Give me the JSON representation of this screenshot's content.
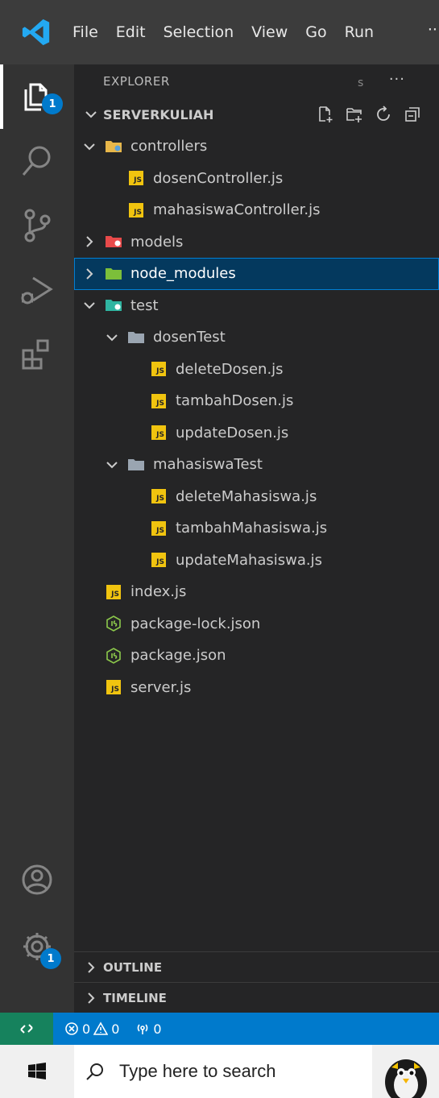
{
  "menubar": {
    "items": [
      "File",
      "Edit",
      "Selection",
      "View",
      "Go",
      "Run"
    ],
    "more": "···"
  },
  "activity": {
    "explorer_badge": "1",
    "settings_badge": "1"
  },
  "sidebar": {
    "title": "EXPLORER",
    "more": "···",
    "editor_peek": "s",
    "root_folder": "SERVERKULIAH",
    "tree": [
      {
        "label": "controllers",
        "icon": "folder-controllers-icon",
        "depth": 1,
        "kind": "folder-open"
      },
      {
        "label": "dosenController.js",
        "icon": "js-file-icon",
        "depth": 2,
        "kind": "js"
      },
      {
        "label": "mahasiswaController.js",
        "icon": "js-file-icon",
        "depth": 2,
        "kind": "js"
      },
      {
        "label": "models",
        "icon": "folder-models-icon",
        "depth": 1,
        "kind": "folder-closed"
      },
      {
        "label": "node_modules",
        "icon": "folder-node-icon",
        "depth": 1,
        "kind": "folder-closed",
        "selected": true
      },
      {
        "label": "test",
        "icon": "folder-test-icon",
        "depth": 1,
        "kind": "folder-open"
      },
      {
        "label": "dosenTest",
        "icon": "folder-icon",
        "depth": 2,
        "kind": "folder-open"
      },
      {
        "label": "deleteDosen.js",
        "icon": "js-file-icon",
        "depth": 3,
        "kind": "js"
      },
      {
        "label": "tambahDosen.js",
        "icon": "js-file-icon",
        "depth": 3,
        "kind": "js"
      },
      {
        "label": "updateDosen.js",
        "icon": "js-file-icon",
        "depth": 3,
        "kind": "js"
      },
      {
        "label": "mahasiswaTest",
        "icon": "folder-icon",
        "depth": 2,
        "kind": "folder-open"
      },
      {
        "label": "deleteMahasiswa.js",
        "icon": "js-file-icon",
        "depth": 3,
        "kind": "js"
      },
      {
        "label": "tambahMahasiswa.js",
        "icon": "js-file-icon",
        "depth": 3,
        "kind": "js"
      },
      {
        "label": "updateMahasiswa.js",
        "icon": "js-file-icon",
        "depth": 3,
        "kind": "js"
      },
      {
        "label": "index.js",
        "icon": "js-file-icon",
        "depth": 1,
        "kind": "js"
      },
      {
        "label": "package-lock.json",
        "icon": "node-json-icon",
        "depth": 1,
        "kind": "json"
      },
      {
        "label": "package.json",
        "icon": "node-json-icon",
        "depth": 1,
        "kind": "json"
      },
      {
        "label": "server.js",
        "icon": "js-file-icon",
        "depth": 1,
        "kind": "js"
      }
    ],
    "js_label": "JS",
    "outline": "OUTLINE",
    "timeline": "TIMELINE"
  },
  "statusbar": {
    "errors": "0",
    "warnings": "0",
    "ports": "0"
  },
  "taskbar": {
    "search_placeholder": "Type here to search"
  },
  "colors": {
    "accent": "#007acc",
    "remote": "#16825d",
    "js": "#f1c40f",
    "selected_bg": "#04395e"
  }
}
